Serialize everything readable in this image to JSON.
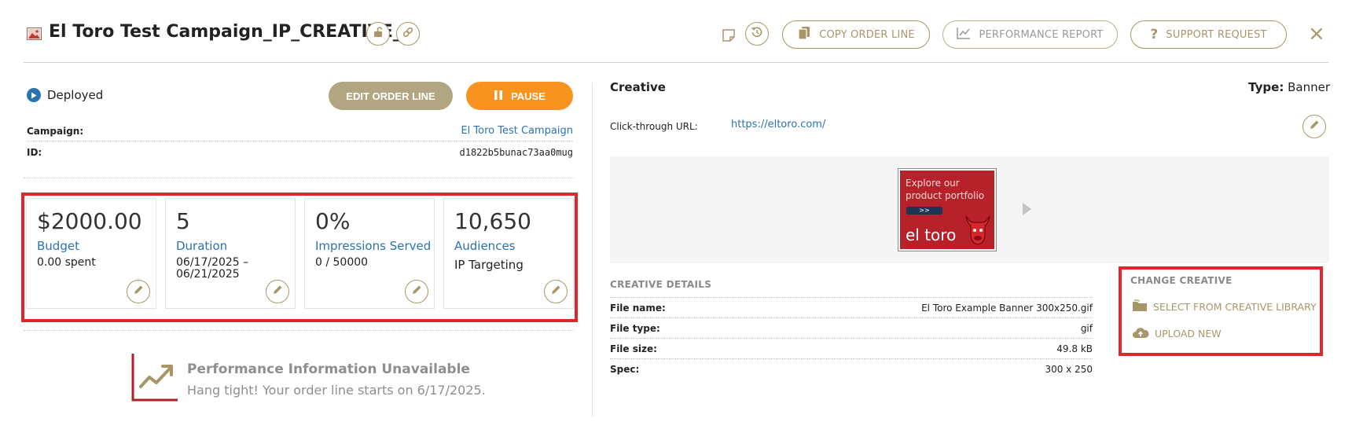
{
  "header": {
    "title": "El Toro Test Campaign_IP_CREATIVE_...",
    "copy_order_line": "COPY ORDER LINE",
    "performance_report": "PERFORMANCE REPORT",
    "support_request": "SUPPORT REQUEST",
    "close": "×"
  },
  "status": {
    "label": "Deployed",
    "edit_button": "EDIT ORDER LINE",
    "pause_button": "PAUSE"
  },
  "details": {
    "campaign_label": "Campaign:",
    "campaign_value": "El Toro Test Campaign",
    "id_label": "ID:",
    "id_value": "d1822b5bunac73aa0mug"
  },
  "cards": [
    {
      "value": "$2000.00",
      "label": "Budget",
      "sub": "0.00 spent"
    },
    {
      "value": "5",
      "label": "Duration",
      "sub": "06/17/2025 –\n06/21/2025"
    },
    {
      "value": "0%",
      "label": "Impressions Served",
      "sub": "0 / 50000"
    },
    {
      "value": "10,650",
      "label": "Audiences",
      "sub": "IP Targeting"
    }
  ],
  "performance": {
    "title": "Performance Information Unavailable",
    "message": "Hang tight! Your order line starts on 6/17/2025."
  },
  "creative": {
    "title": "Creative",
    "type_label": "Type:",
    "type_value": "Banner",
    "click_through_label": "Click-through URL:",
    "click_through_url": "https://eltoro.com/",
    "banner": {
      "text": "Explore our\nproduct portfolio",
      "button": ">>",
      "brand": "el toro"
    },
    "details_title": "CREATIVE DETAILS",
    "details": [
      {
        "label": "File name:",
        "value": "El Toro Example Banner 300x250.gif"
      },
      {
        "label": "File type:",
        "value": "gif"
      },
      {
        "label": "File size:",
        "value": "49.8 kB"
      },
      {
        "label": "Spec:",
        "value": "300 x 250"
      }
    ],
    "change_title": "CHANGE CREATIVE",
    "select_library": "SELECT FROM CREATIVE LIBRARY",
    "upload_new": "UPLOAD NEW"
  },
  "colors": {
    "gold": "#a89668",
    "link_blue": "#2a73b3",
    "pause_orange": "#f7931e",
    "highlight_red": "#e0262a"
  }
}
